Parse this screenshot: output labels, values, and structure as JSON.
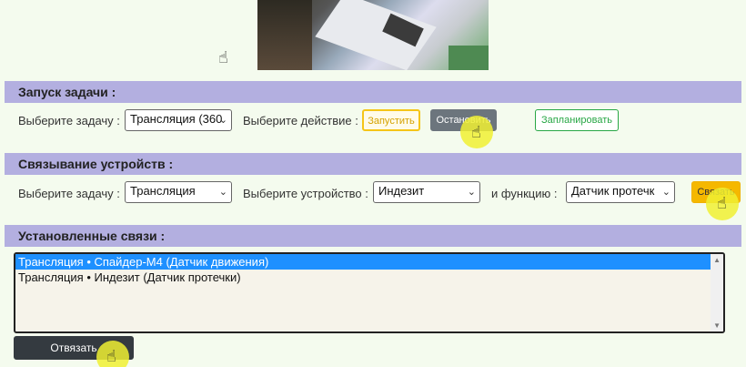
{
  "task_section": {
    "title": "Запуск задачи :",
    "select_task_label": "Выберите задачу :",
    "task_value": "Трансляция (360",
    "select_action_label": "Выберите действие :",
    "start_button": "Запустить",
    "stop_button": "Остановить",
    "schedule_button": "Запланировать"
  },
  "link_section": {
    "title": "Связывание устройств :",
    "select_task_label": "Выберите задачу :",
    "task_value": "Трансляция",
    "select_device_label": "Выберите устройство :",
    "device_value": "Индезит",
    "function_label": "и функцию :",
    "function_value": "Датчик протечк",
    "link_button": "Связать"
  },
  "established_section": {
    "title": "Установленные связи :",
    "items": [
      "Трансляция • Спайдер-М4 (Датчик движения)",
      "Трансляция • Индезит (Датчик протечки)"
    ],
    "unlink_button": "Отвязать"
  },
  "colors": {
    "section_bar": "#b3afe0",
    "background": "#f4fbee",
    "selected_item": "#1e90ff",
    "halo": "#f0f032"
  },
  "icons": {
    "cursor": "hand-pointer-icon",
    "dropdown": "chevron-down-icon"
  }
}
